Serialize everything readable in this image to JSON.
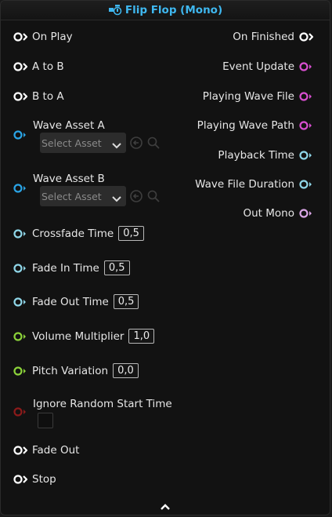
{
  "node": {
    "title": "Flip Flop (Mono)",
    "title_color": "#3fb8f0",
    "header_icon": "flip-flop-icon"
  },
  "left_exec_pins": [
    {
      "label": "On Play"
    },
    {
      "label": "A to B"
    },
    {
      "label": "B to A"
    }
  ],
  "assets": [
    {
      "label": "Wave Asset A",
      "select_value": "Select Asset"
    },
    {
      "label": "Wave Asset B",
      "select_value": "Select Asset"
    }
  ],
  "left_inputs": [
    {
      "label": "Crossfade Time",
      "value": "0,5"
    },
    {
      "label": "Fade In Time",
      "value": "0,5"
    },
    {
      "label": "Fade Out Time",
      "value": "0,5"
    },
    {
      "label": "Volume Multiplier",
      "value": "1,0"
    },
    {
      "label": "Pitch Variation",
      "value": "0,0"
    }
  ],
  "ignore_random": {
    "label": "Ignore Random Start Time",
    "checked": false
  },
  "left_trigger_pins": [
    {
      "label": "Fade Out"
    },
    {
      "label": "Stop"
    }
  ],
  "right_pins": [
    {
      "label": "On Finished"
    },
    {
      "label": "Event Update"
    },
    {
      "label": "Playing Wave File"
    },
    {
      "label": "Playing Wave Path"
    },
    {
      "label": "Playback Time"
    },
    {
      "label": "Wave File Duration"
    },
    {
      "label": "Out Mono"
    }
  ],
  "pin_colors": {
    "exec": "#ffffff",
    "wave": "#2aa4e6",
    "float": "#8fd6e8",
    "float_green": "#8cd23a",
    "bool": "#8b1a1a",
    "pink": "#d84fd0"
  },
  "icons": {
    "select_chevron": "chevron-down-icon",
    "use_selected": "arrow-left-circle-icon",
    "browse": "search-icon",
    "collapse": "chevron-up-icon"
  }
}
